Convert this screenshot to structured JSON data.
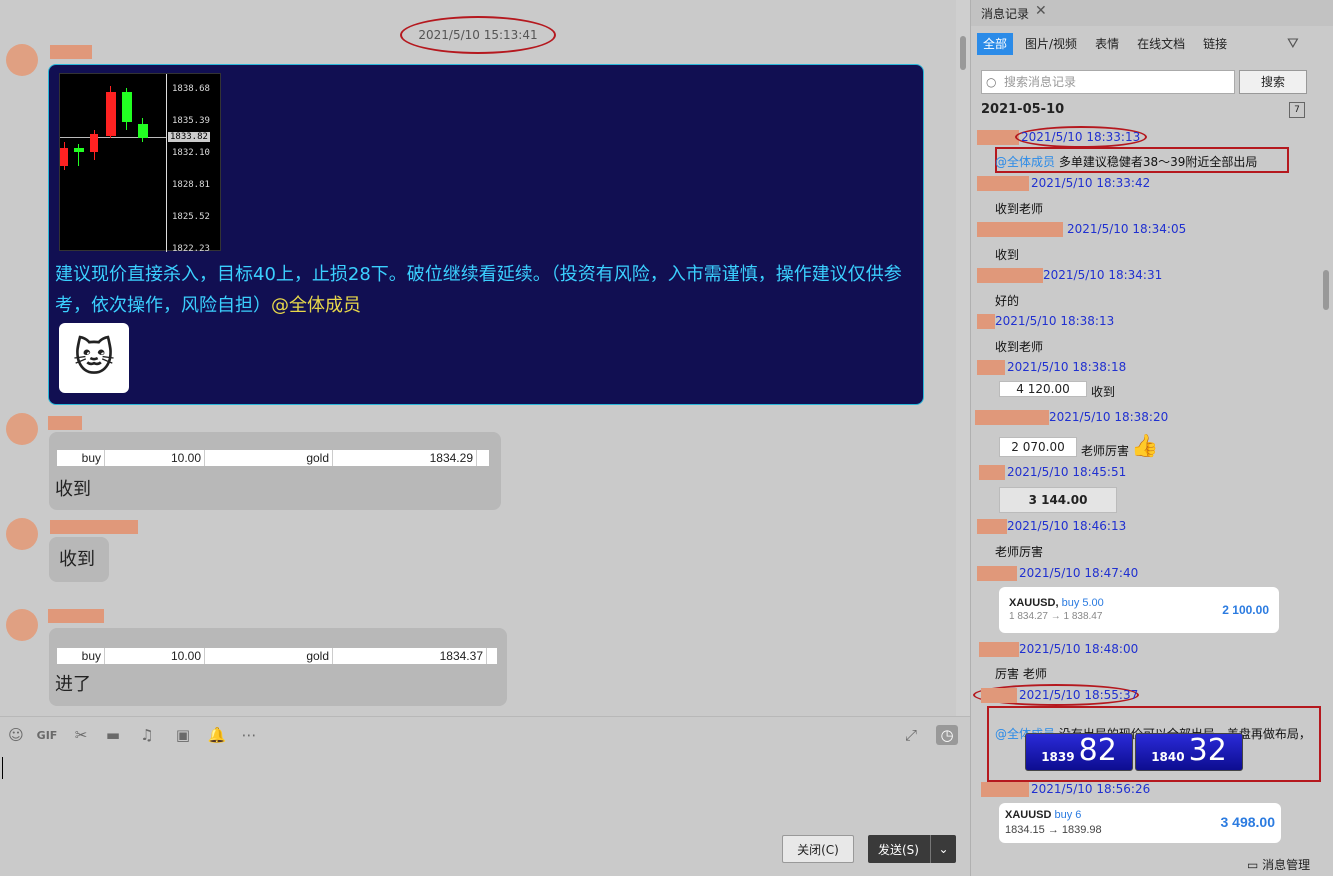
{
  "chat": {
    "center_timestamp": "2021/5/10 15:13:41",
    "chart_labels": [
      "1838.68",
      "1835.39",
      "1832.10",
      "1828.81",
      "1825.52",
      "1822.23"
    ],
    "chart_current": "1833.82",
    "message1_text": "建议现价直接杀入，目标40上，止损28下。破位继续看延续。（投资有风险，入市需谨慎，操作建议仅供参考，依次操作，风险自担）",
    "message1_mention": "@全体成员",
    "row1": {
      "side": "buy",
      "qty": "10.00",
      "symbol": "gold",
      "price": "1834.29"
    },
    "message2_text": "收到",
    "message3_text": "收到",
    "row2": {
      "side": "buy",
      "qty": "10.00",
      "symbol": "gold",
      "price": "1834.37"
    },
    "message4_text": "进了"
  },
  "toolbar": {
    "close_label": "关闭(C)",
    "send_label": "发送(S)"
  },
  "history": {
    "tab_title": "消息记录",
    "filters": [
      "全部",
      "图片/视频",
      "表情",
      "在线文档",
      "链接"
    ],
    "search_placeholder": "搜索消息记录",
    "search_button": "搜索",
    "date": "2021-05-10",
    "entries": [
      {
        "ts": "2021/5/10 18:33:13",
        "mention": "@全体成员",
        "text": "多单建议稳健者38～39附近全部出局"
      },
      {
        "ts": "2021/5/10 18:33:42",
        "text": "收到老师"
      },
      {
        "ts": "2021/5/10 18:34:05",
        "text": "收到"
      },
      {
        "ts": "2021/5/10 18:34:31",
        "text": "好的"
      },
      {
        "ts": "2021/5/10 18:38:13",
        "text": "收到老师"
      },
      {
        "ts": "2021/5/10 18:38:18",
        "box": "4 120.00",
        "text": "收到"
      },
      {
        "ts": "2021/5/10 18:38:20",
        "box": "2 070.00",
        "text": "老师厉害"
      },
      {
        "ts": "2021/5/10 18:45:51",
        "box": "3 144.00"
      },
      {
        "ts": "2021/5/10 18:46:13",
        "text": "老师厉害"
      },
      {
        "ts": "2021/5/10 18:47:40"
      },
      {
        "ts": "2021/5/10 18:48:00",
        "text": "厉害 老师"
      },
      {
        "ts": "2021/5/10 18:55:37",
        "mention": "@全体成员",
        "text": "没有出局的现价可以全部出局，美盘再做布局，"
      },
      {
        "ts": "2021/5/10 18:56:26"
      }
    ],
    "card1": {
      "symbol": "XAUUSD,",
      "action": "buy 5.00",
      "prices": "1 834.27 → 1 838.47",
      "profit": "2 100.00"
    },
    "quote": {
      "bid_small": "1839",
      "bid_large": "82",
      "ask_small": "1840",
      "ask_large": "32"
    },
    "card2": {
      "symbol": "XAUUSD",
      "action": "buy 6",
      "prices": "1834.15 → 1839.98",
      "profit": "3 498.00"
    },
    "manage_label": "消息管理"
  }
}
